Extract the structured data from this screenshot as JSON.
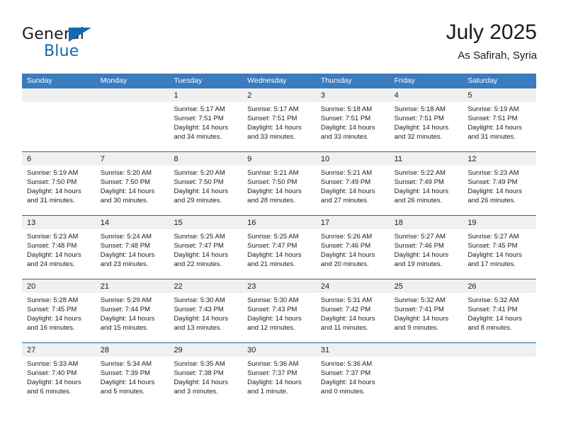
{
  "logo": {
    "word1": "General",
    "word2": "Blue",
    "triangle_icon": "blue-triangle",
    "accent_color": "#1268b3"
  },
  "header": {
    "title": "July 2025",
    "subtitle": "As Safirah, Syria"
  },
  "colors": {
    "header_row_bg": "#3a7cbe",
    "week_divider": "#1d67a5",
    "day_band_bg": "#f0f0f0",
    "text": "#1b1b1b"
  },
  "weekdays": [
    "Sunday",
    "Monday",
    "Tuesday",
    "Wednesday",
    "Thursday",
    "Friday",
    "Saturday"
  ],
  "weeks": [
    [
      {
        "day": "",
        "empty": true
      },
      {
        "day": "",
        "empty": true
      },
      {
        "day": "1",
        "sunrise": "Sunrise: 5:17 AM",
        "sunset": "Sunset: 7:51 PM",
        "daylight": "Daylight: 14 hours and 34 minutes."
      },
      {
        "day": "2",
        "sunrise": "Sunrise: 5:17 AM",
        "sunset": "Sunset: 7:51 PM",
        "daylight": "Daylight: 14 hours and 33 minutes."
      },
      {
        "day": "3",
        "sunrise": "Sunrise: 5:18 AM",
        "sunset": "Sunset: 7:51 PM",
        "daylight": "Daylight: 14 hours and 33 minutes."
      },
      {
        "day": "4",
        "sunrise": "Sunrise: 5:18 AM",
        "sunset": "Sunset: 7:51 PM",
        "daylight": "Daylight: 14 hours and 32 minutes."
      },
      {
        "day": "5",
        "sunrise": "Sunrise: 5:19 AM",
        "sunset": "Sunset: 7:51 PM",
        "daylight": "Daylight: 14 hours and 31 minutes."
      }
    ],
    [
      {
        "day": "6",
        "sunrise": "Sunrise: 5:19 AM",
        "sunset": "Sunset: 7:50 PM",
        "daylight": "Daylight: 14 hours and 31 minutes."
      },
      {
        "day": "7",
        "sunrise": "Sunrise: 5:20 AM",
        "sunset": "Sunset: 7:50 PM",
        "daylight": "Daylight: 14 hours and 30 minutes."
      },
      {
        "day": "8",
        "sunrise": "Sunrise: 5:20 AM",
        "sunset": "Sunset: 7:50 PM",
        "daylight": "Daylight: 14 hours and 29 minutes."
      },
      {
        "day": "9",
        "sunrise": "Sunrise: 5:21 AM",
        "sunset": "Sunset: 7:50 PM",
        "daylight": "Daylight: 14 hours and 28 minutes."
      },
      {
        "day": "10",
        "sunrise": "Sunrise: 5:21 AM",
        "sunset": "Sunset: 7:49 PM",
        "daylight": "Daylight: 14 hours and 27 minutes."
      },
      {
        "day": "11",
        "sunrise": "Sunrise: 5:22 AM",
        "sunset": "Sunset: 7:49 PM",
        "daylight": "Daylight: 14 hours and 26 minutes."
      },
      {
        "day": "12",
        "sunrise": "Sunrise: 5:23 AM",
        "sunset": "Sunset: 7:49 PM",
        "daylight": "Daylight: 14 hours and 26 minutes."
      }
    ],
    [
      {
        "day": "13",
        "sunrise": "Sunrise: 5:23 AM",
        "sunset": "Sunset: 7:48 PM",
        "daylight": "Daylight: 14 hours and 24 minutes."
      },
      {
        "day": "14",
        "sunrise": "Sunrise: 5:24 AM",
        "sunset": "Sunset: 7:48 PM",
        "daylight": "Daylight: 14 hours and 23 minutes."
      },
      {
        "day": "15",
        "sunrise": "Sunrise: 5:25 AM",
        "sunset": "Sunset: 7:47 PM",
        "daylight": "Daylight: 14 hours and 22 minutes."
      },
      {
        "day": "16",
        "sunrise": "Sunrise: 5:25 AM",
        "sunset": "Sunset: 7:47 PM",
        "daylight": "Daylight: 14 hours and 21 minutes."
      },
      {
        "day": "17",
        "sunrise": "Sunrise: 5:26 AM",
        "sunset": "Sunset: 7:46 PM",
        "daylight": "Daylight: 14 hours and 20 minutes."
      },
      {
        "day": "18",
        "sunrise": "Sunrise: 5:27 AM",
        "sunset": "Sunset: 7:46 PM",
        "daylight": "Daylight: 14 hours and 19 minutes."
      },
      {
        "day": "19",
        "sunrise": "Sunrise: 5:27 AM",
        "sunset": "Sunset: 7:45 PM",
        "daylight": "Daylight: 14 hours and 17 minutes."
      }
    ],
    [
      {
        "day": "20",
        "sunrise": "Sunrise: 5:28 AM",
        "sunset": "Sunset: 7:45 PM",
        "daylight": "Daylight: 14 hours and 16 minutes."
      },
      {
        "day": "21",
        "sunrise": "Sunrise: 5:29 AM",
        "sunset": "Sunset: 7:44 PM",
        "daylight": "Daylight: 14 hours and 15 minutes."
      },
      {
        "day": "22",
        "sunrise": "Sunrise: 5:30 AM",
        "sunset": "Sunset: 7:43 PM",
        "daylight": "Daylight: 14 hours and 13 minutes."
      },
      {
        "day": "23",
        "sunrise": "Sunrise: 5:30 AM",
        "sunset": "Sunset: 7:43 PM",
        "daylight": "Daylight: 14 hours and 12 minutes."
      },
      {
        "day": "24",
        "sunrise": "Sunrise: 5:31 AM",
        "sunset": "Sunset: 7:42 PM",
        "daylight": "Daylight: 14 hours and 11 minutes."
      },
      {
        "day": "25",
        "sunrise": "Sunrise: 5:32 AM",
        "sunset": "Sunset: 7:41 PM",
        "daylight": "Daylight: 14 hours and 9 minutes."
      },
      {
        "day": "26",
        "sunrise": "Sunrise: 5:32 AM",
        "sunset": "Sunset: 7:41 PM",
        "daylight": "Daylight: 14 hours and 8 minutes."
      }
    ],
    [
      {
        "day": "27",
        "sunrise": "Sunrise: 5:33 AM",
        "sunset": "Sunset: 7:40 PM",
        "daylight": "Daylight: 14 hours and 6 minutes."
      },
      {
        "day": "28",
        "sunrise": "Sunrise: 5:34 AM",
        "sunset": "Sunset: 7:39 PM",
        "daylight": "Daylight: 14 hours and 5 minutes."
      },
      {
        "day": "29",
        "sunrise": "Sunrise: 5:35 AM",
        "sunset": "Sunset: 7:38 PM",
        "daylight": "Daylight: 14 hours and 3 minutes."
      },
      {
        "day": "30",
        "sunrise": "Sunrise: 5:36 AM",
        "sunset": "Sunset: 7:37 PM",
        "daylight": "Daylight: 14 hours and 1 minute."
      },
      {
        "day": "31",
        "sunrise": "Sunrise: 5:36 AM",
        "sunset": "Sunset: 7:37 PM",
        "daylight": "Daylight: 14 hours and 0 minutes."
      },
      {
        "day": "",
        "empty": true
      },
      {
        "day": "",
        "empty": true
      }
    ]
  ]
}
